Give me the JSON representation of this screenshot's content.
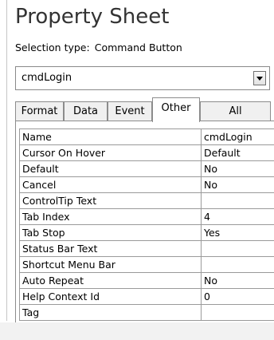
{
  "panel": {
    "title": "Property Sheet",
    "selection_type_label": "Selection type:",
    "selection_type_value": "Command Button"
  },
  "object_selector": {
    "value": "cmdLogin",
    "dropdown_icon": "chevron-down-icon"
  },
  "tabs": [
    {
      "label": "Format",
      "active": false
    },
    {
      "label": "Data",
      "active": false
    },
    {
      "label": "Event",
      "active": false
    },
    {
      "label": "Other",
      "active": true
    },
    {
      "label": "All",
      "active": false
    }
  ],
  "properties": [
    {
      "name": "Name",
      "value": "cmdLogin"
    },
    {
      "name": "Cursor On Hover",
      "value": "Default"
    },
    {
      "name": "Default",
      "value": "No"
    },
    {
      "name": "Cancel",
      "value": "No"
    },
    {
      "name": "ControlTip Text",
      "value": ""
    },
    {
      "name": "Tab Index",
      "value": "4"
    },
    {
      "name": "Tab Stop",
      "value": "Yes"
    },
    {
      "name": "Status Bar Text",
      "value": ""
    },
    {
      "name": "Shortcut Menu Bar",
      "value": ""
    },
    {
      "name": "Auto Repeat",
      "value": "No"
    },
    {
      "name": "Help Context Id",
      "value": "0"
    },
    {
      "name": "Tag",
      "value": ""
    }
  ]
}
